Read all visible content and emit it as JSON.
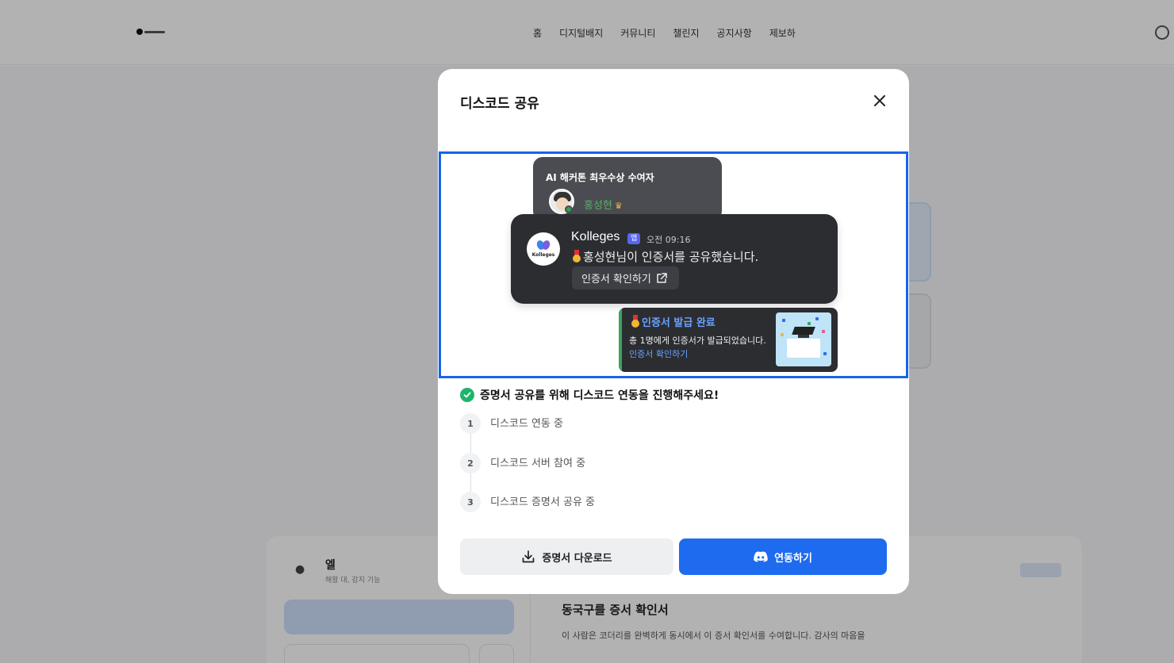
{
  "background": {
    "nav": [
      "홈",
      "디지털배지",
      "커뮤니티",
      "챌린지",
      "공지사항",
      "제보하"
    ],
    "right_panel_title": "동국구를 증서 확인서",
    "right_panel_desc": "이 사람은 코더리를 완벽하게 동시에서 이 증서 확인서를 수여합니다. 감사의 마음을",
    "left_panel_title": "엘",
    "left_panel_sub": "해왕 대, 감지 기능"
  },
  "modal": {
    "title": "디스코드 공유",
    "close_icon": "close-icon",
    "preview": {
      "top_card": {
        "title": "AI 해커톤 최우수상 수여자",
        "user_name": "홍성현",
        "crown": "♛"
      },
      "main_card": {
        "bot_name": "Kolleges",
        "logo_text": "Kolleges",
        "app_badge": "앱",
        "time": "오전 09:16",
        "message": "홍성현님이 인증서를 공유했습니다.",
        "button_label": "인증서 확인하기"
      },
      "issued_card": {
        "title": "인증서 발급 완료",
        "description": "총 1명에게 인증서가 발급되었습니다.",
        "link": "인증서 확인하기"
      }
    },
    "status": "증명서 공유를 위해 디스코드 연동을 진행해주세요!",
    "steps": [
      {
        "num": "1",
        "label": "디스코드 연동 중"
      },
      {
        "num": "2",
        "label": "디스코드 서버 참여 중"
      },
      {
        "num": "3",
        "label": "디스코드 증명서 공유 중"
      }
    ],
    "download_label": "증명서 다운로드",
    "connect_label": "연동하기",
    "colors": {
      "accent": "#1f6bf0",
      "preview_border": "#1a63e8",
      "success": "#1fb46c",
      "discord_dark": "#2b2d31"
    }
  }
}
